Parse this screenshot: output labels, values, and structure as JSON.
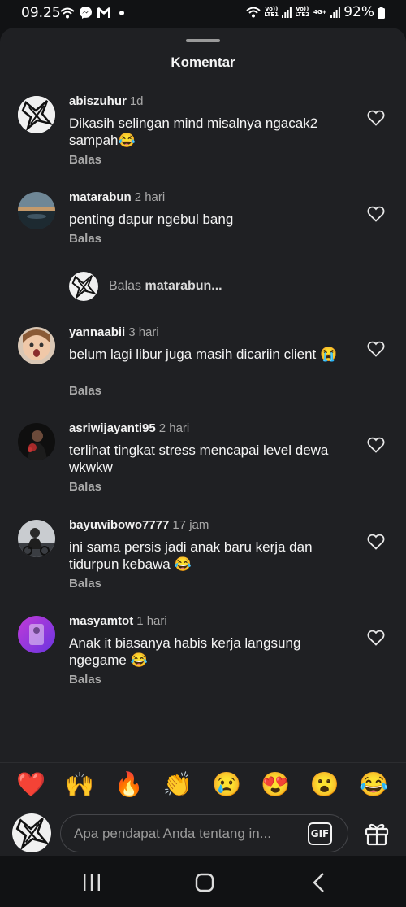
{
  "status_bar": {
    "time": "09.25",
    "network_labels": [
      "Vo)) LTE1",
      "Vo)) LTE2",
      "4G+"
    ],
    "battery": "92%",
    "icons": [
      "wifi-call-icon",
      "messenger-icon",
      "gmail-icon",
      "dot-icon",
      "wifi-icon",
      "signal-icon",
      "battery-icon"
    ]
  },
  "sheet": {
    "title": "Komentar"
  },
  "comments": [
    {
      "user": "abiszuhur",
      "time": "1d",
      "text": "Dikasih selingan mind misalnya ngacak2 sampah😂",
      "reply": "Balas"
    },
    {
      "user": "matarabun",
      "time": "2 hari",
      "text": "penting dapur ngebul bang",
      "reply": "Balas"
    },
    {
      "user": "yannaabii",
      "time": "3 hari",
      "text": "belum lagi libur juga masih dicariin client 😭",
      "reply": "Balas"
    },
    {
      "user": "asriwijayanti95",
      "time": "2 hari",
      "text": "terlihat tingkat stress mencapai level dewa wkwkw",
      "reply": "Balas"
    },
    {
      "user": "bayuwibowo7777",
      "time": "17 jam",
      "text": "ini sama persis jadi anak baru kerja dan tidurpun kebawa 😂",
      "reply": "Balas"
    },
    {
      "user": "masyamtot",
      "time": "1 hari",
      "text": "Anak it biasanya habis kerja langsung ngegame 😂",
      "reply": "Balas"
    }
  ],
  "reply_prompt": {
    "prefix": "Balas",
    "target": "matarabun..."
  },
  "emoji_bar": [
    "❤️",
    "🙌",
    "🔥",
    "👏",
    "😢",
    "😍",
    "😮",
    "😂"
  ],
  "composer": {
    "placeholder": "Apa pendapat Anda tentang in...",
    "gif_label": "GIF"
  },
  "colors": {
    "sheet_bg": "#1f2023",
    "screen_bg": "#111214",
    "muted_text": "#a8a8a8"
  }
}
